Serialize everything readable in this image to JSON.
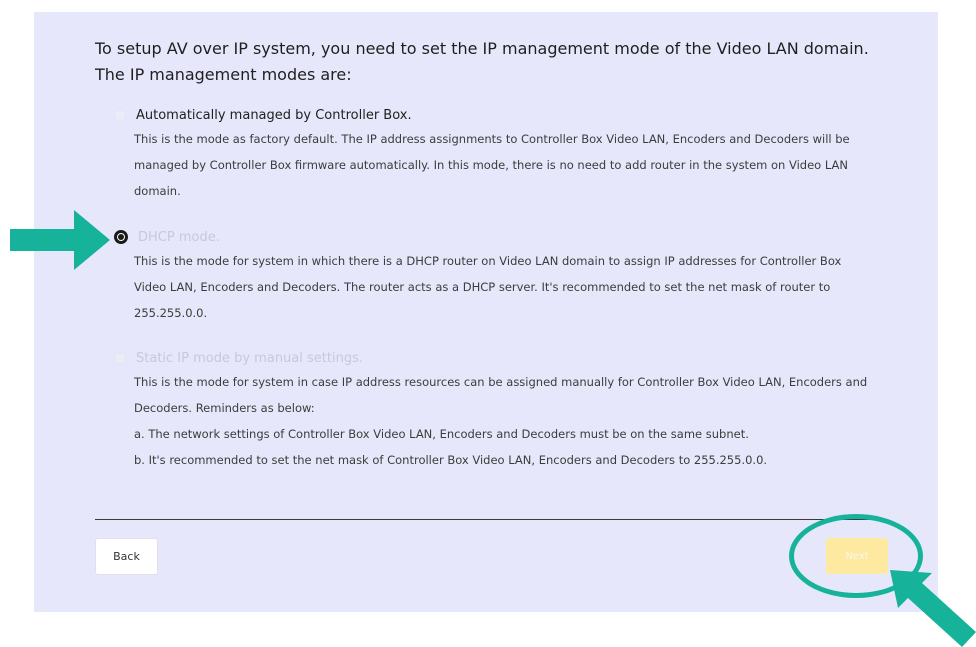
{
  "heading": "To setup AV over IP system, you need to set the IP management mode of the Video LAN domain. The IP management modes are:",
  "options": [
    {
      "label": "Automatically managed by Controller Box.",
      "selected": false,
      "description": "This is the mode as factory default. The IP address assignments to Controller Box Video LAN, Encoders and Decoders will be managed by Controller Box firmware automatically. In this mode, there is no need to add router in the system on Video LAN domain."
    },
    {
      "label": "DHCP mode.",
      "selected": true,
      "description": "This is the mode for system in which there is a DHCP router on Video LAN domain to assign IP addresses for Controller Box Video LAN, Encoders and Decoders. The router acts as a DHCP server. It's recommended to set the net mask of router to 255.255.0.0."
    },
    {
      "label": "Static IP mode by manual settings.",
      "selected": false,
      "description": "This is the mode for system in case IP address resources can be assigned manually for Controller Box Video LAN, Encoders and Decoders. Reminders as below:",
      "notes": [
        "a. The network settings of Controller Box Video LAN, Encoders and Decoders must be on the same subnet.",
        "b. It's recommended to set the net mask of Controller Box Video LAN, Encoders and Decoders to 255.255.0.0."
      ]
    }
  ],
  "buttons": {
    "back": "Back",
    "next": "Next"
  },
  "colors": {
    "panel_background": "#e7e7fb",
    "annotation_teal": "#16b39a",
    "next_button": "#fdeaa0"
  },
  "annotations": {
    "left_arrow": "arrow-right-icon",
    "corner_arrow": "arrow-up-left-icon",
    "highlight": "next-button-highlight-ellipse"
  }
}
